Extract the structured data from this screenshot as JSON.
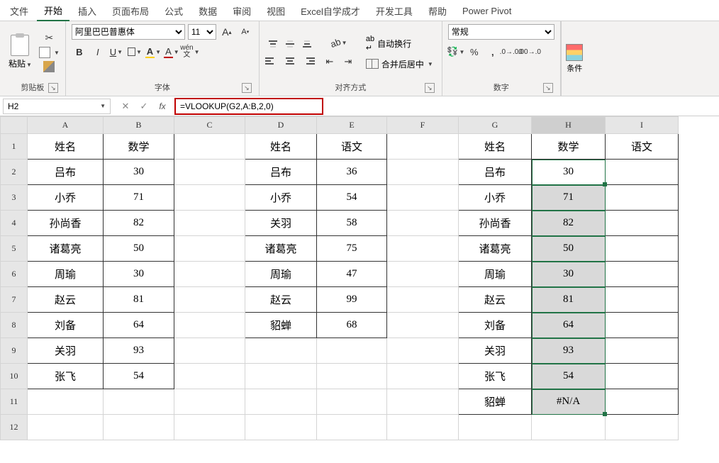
{
  "tabs": [
    "文件",
    "开始",
    "插入",
    "页面布局",
    "公式",
    "数据",
    "审阅",
    "视图",
    "Excel自学成才",
    "开发工具",
    "帮助",
    "Power Pivot"
  ],
  "active_tab_index": 1,
  "ribbon": {
    "clipboard": {
      "label": "剪贴板",
      "paste": "粘贴"
    },
    "font": {
      "label": "字体",
      "name": "阿里巴巴普惠体",
      "size": "11"
    },
    "align": {
      "label": "对齐方式",
      "wrap": "自动换行",
      "merge": "合并后居中"
    },
    "number": {
      "label": "数字",
      "format": "常规"
    },
    "cf": {
      "label": "条件"
    }
  },
  "namebox": "H2",
  "formula": "=VLOOKUP(G2,A:B,2,0)",
  "columns": [
    "A",
    "B",
    "C",
    "D",
    "E",
    "F",
    "G",
    "H",
    "I"
  ],
  "rows": [
    1,
    2,
    3,
    4,
    5,
    6,
    7,
    8,
    9,
    10,
    11,
    12
  ],
  "cells": {
    "A1": "姓名",
    "B1": "数学",
    "D1": "姓名",
    "E1": "语文",
    "G1": "姓名",
    "H1": "数学",
    "I1": "语文",
    "A2": "吕布",
    "B2": "30",
    "D2": "吕布",
    "E2": "36",
    "G2": "吕布",
    "H2": "30",
    "A3": "小乔",
    "B3": "71",
    "D3": "小乔",
    "E3": "54",
    "G3": "小乔",
    "H3": "71",
    "A4": "孙尚香",
    "B4": "82",
    "D4": "关羽",
    "E4": "58",
    "G4": "孙尚香",
    "H4": "82",
    "A5": "诸葛亮",
    "B5": "50",
    "D5": "诸葛亮",
    "E5": "75",
    "G5": "诸葛亮",
    "H5": "50",
    "A6": "周瑜",
    "B6": "30",
    "D6": "周瑜",
    "E6": "47",
    "G6": "周瑜",
    "H6": "30",
    "A7": "赵云",
    "B7": "81",
    "D7": "赵云",
    "E7": "99",
    "G7": "赵云",
    "H7": "81",
    "A8": "刘备",
    "B8": "64",
    "D8": "貂蝉",
    "E8": "68",
    "G8": "刘备",
    "H8": "64",
    "A9": "关羽",
    "B9": "93",
    "G9": "关羽",
    "H9": "93",
    "A10": "张飞",
    "B10": "54",
    "G10": "张飞",
    "H10": "54",
    "G11": "貂蝉",
    "H11": "#N/A"
  },
  "bordered_ranges": [
    {
      "r1": 1,
      "r2": 10,
      "c1": "A",
      "c2": "B"
    },
    {
      "r1": 1,
      "r2": 8,
      "c1": "D",
      "c2": "E"
    },
    {
      "r1": 1,
      "r2": 11,
      "c1": "G",
      "c2": "I"
    }
  ],
  "fill_cells": [
    "H3",
    "H4",
    "H5",
    "H6",
    "H7",
    "H8",
    "H9",
    "H10",
    "H11"
  ],
  "active_cell": "H2",
  "selection": {
    "r1": 2,
    "r2": 11,
    "c": "H"
  }
}
